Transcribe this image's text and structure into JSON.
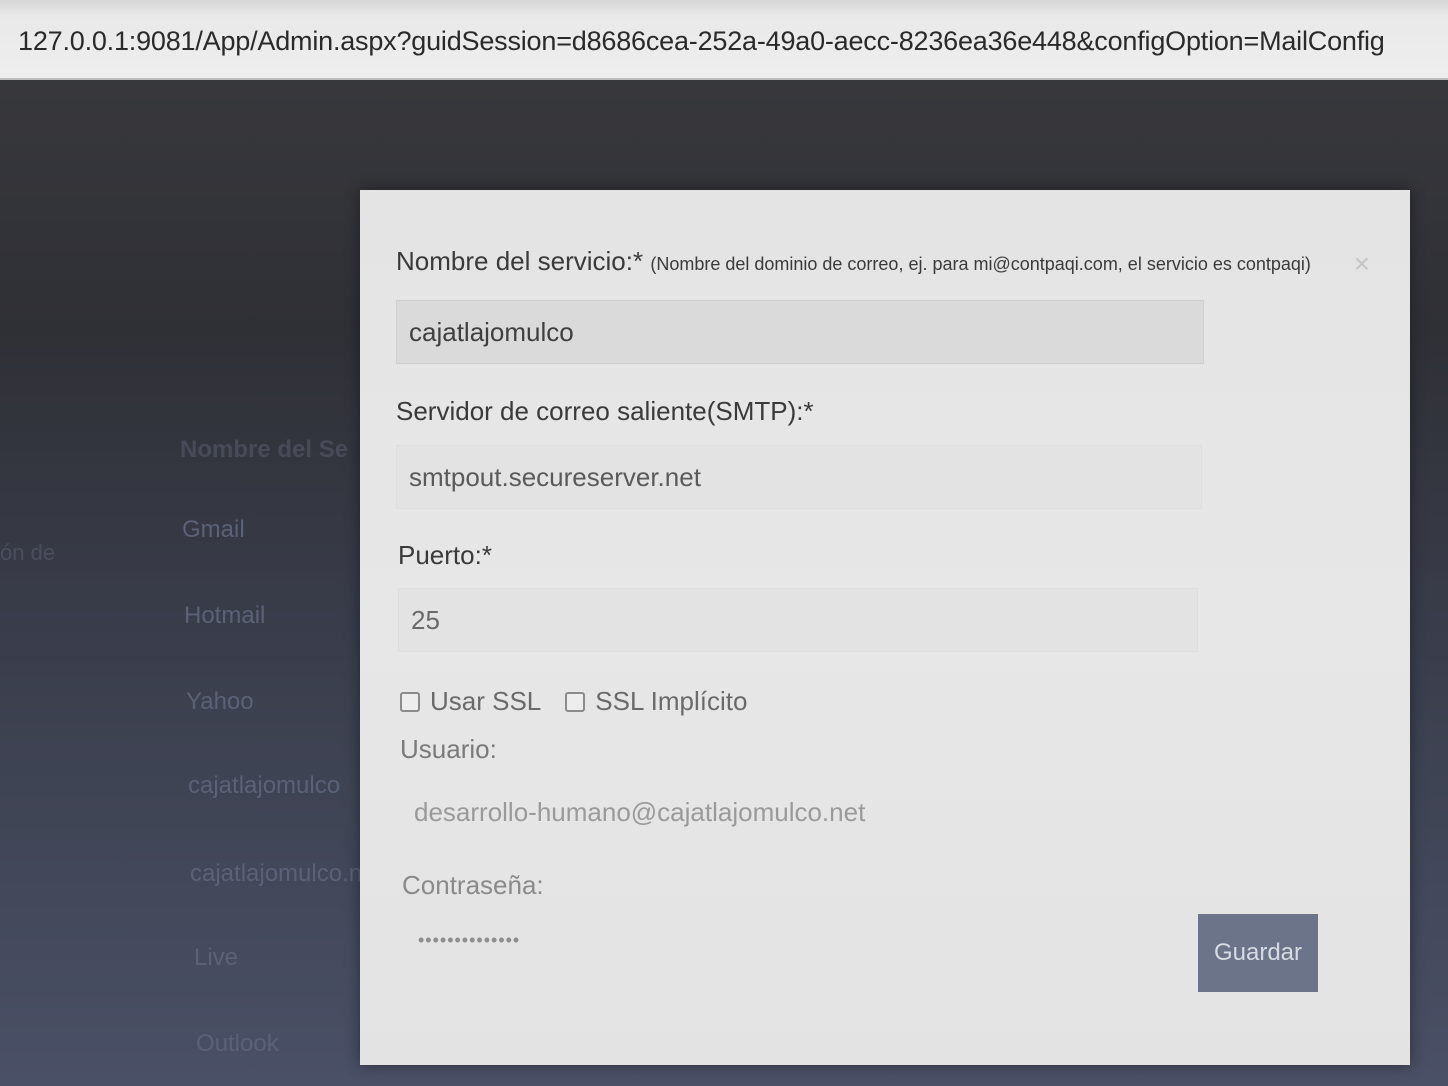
{
  "browser": {
    "url": "127.0.0.1:9081/App/Admin.aspx?guidSession=d8686cea-252a-49a0-aecc-8236ea36e448&configOption=MailConfig"
  },
  "background": {
    "heading": "Nombre del Se",
    "side_text": "ón de",
    "items": [
      "Gmail",
      "Hotmail",
      "Yahoo",
      "cajatlajomulco",
      "cajatlajomulco.n",
      "Live",
      "Outlook"
    ]
  },
  "modal": {
    "close_glyph": "×",
    "service_label": "Nombre del servicio:*",
    "service_hint": "(Nombre del dominio de correo, ej. para mi@contpaqi.com, el servicio es contpaqi)",
    "service_value": "cajatlajomulco",
    "smtp_label": "Servidor de correo saliente(SMTP):*",
    "smtp_value": "smtpout.secureserver.net",
    "port_label": "Puerto:*",
    "port_value": "25",
    "ssl_label": "Usar SSL",
    "ssl_checked": false,
    "implicit_ssl_label": "SSL Implícito",
    "implicit_ssl_checked": false,
    "user_label": "Usuario:",
    "user_value": "desarrollo-humano@cajatlajomulco.net",
    "password_label": "Contraseña:",
    "password_mask": "••••••••••••••",
    "save_label": "Guardar"
  }
}
